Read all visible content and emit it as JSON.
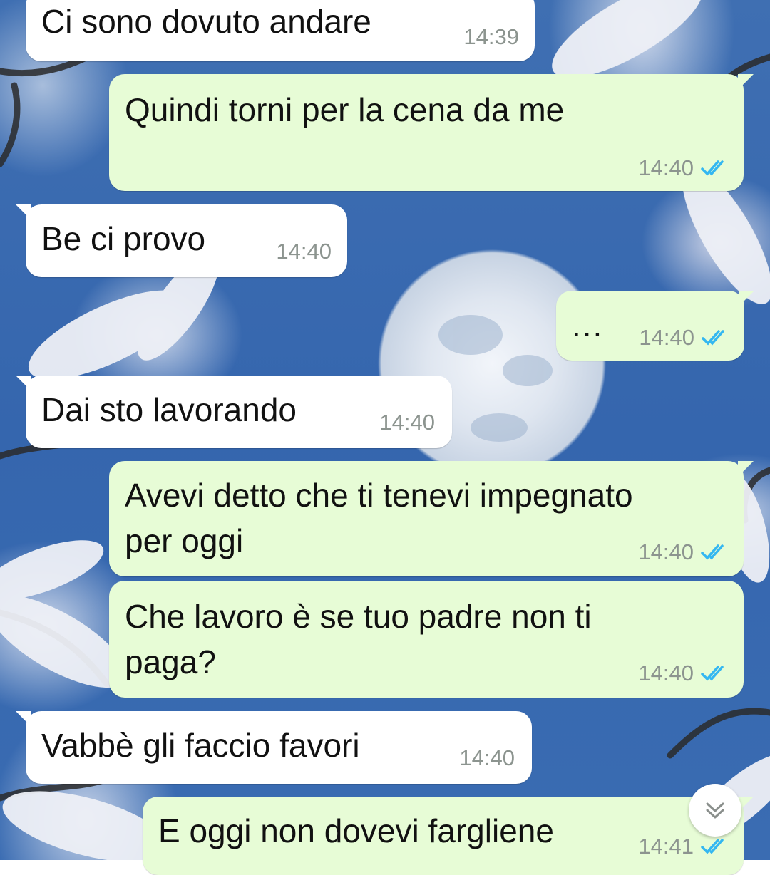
{
  "chat": {
    "messages": [
      {
        "direction": "in",
        "text": "Ci sono dovuto andare",
        "time": "14:39"
      },
      {
        "direction": "out",
        "text": "Quindi torni per la cena da me",
        "time": "14:40",
        "status": "read"
      },
      {
        "direction": "in",
        "text": "Be ci provo",
        "time": "14:40"
      },
      {
        "direction": "out",
        "text": "...",
        "time": "14:40",
        "status": "read"
      },
      {
        "direction": "in",
        "text": "Dai sto lavorando",
        "time": "14:40"
      },
      {
        "direction": "out",
        "text": "Avevi detto che ti tenevi impegnato\nper oggi",
        "time": "14:40",
        "status": "read"
      },
      {
        "direction": "out",
        "text": "Che lavoro è se tuo padre non ti\npaga?",
        "time": "14:40",
        "status": "read"
      },
      {
        "direction": "in",
        "text": "Vabbè gli faccio favori",
        "time": "14:40"
      },
      {
        "direction": "out",
        "text": "E oggi non dovevi fargliene",
        "time": "14:41",
        "status": "read"
      }
    ]
  },
  "icons": {
    "read_receipt": "double-check-icon",
    "scroll_down": "chevron-double-down-icon"
  },
  "colors": {
    "incoming_bubble": "#ffffff",
    "outgoing_bubble": "#e7fcd6",
    "read_tick": "#34b7f1",
    "timestamp": "#8c948f",
    "wallpaper_sky": "#3566ae"
  }
}
